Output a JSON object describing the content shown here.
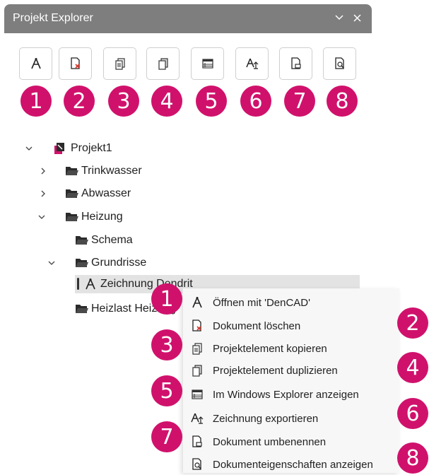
{
  "panel": {
    "title": "Projekt Explorer",
    "controls": {
      "collapse": "⌄",
      "close": "✕"
    }
  },
  "toolbar": {
    "buttons": [
      {
        "icon": "open-drawing-icon"
      },
      {
        "icon": "delete-document-icon"
      },
      {
        "icon": "copy-element-icon"
      },
      {
        "icon": "duplicate-element-icon"
      },
      {
        "icon": "windows-explorer-icon"
      },
      {
        "icon": "export-drawing-icon"
      },
      {
        "icon": "rename-document-icon"
      },
      {
        "icon": "document-properties-icon"
      }
    ]
  },
  "badges": [
    "1",
    "2",
    "3",
    "4",
    "5",
    "6",
    "7",
    "8"
  ],
  "tree": {
    "project": "Projekt1",
    "trinkwasser": "Trinkwasser",
    "abwasser": "Abwasser",
    "heizung": "Heizung",
    "schema": "Schema",
    "grundrisse": "Grundrisse",
    "zeichnung": "Zeichnung Dendrit",
    "heizlast": "Heizlast Heizung"
  },
  "context_menu": {
    "items": [
      {
        "label": "Öffnen mit 'DenCAD'",
        "icon": "open-drawing-icon"
      },
      {
        "label": "Dokument löschen",
        "icon": "delete-document-icon"
      },
      {
        "label": "Projektelement kopieren",
        "icon": "copy-element-icon"
      },
      {
        "label": "Projektelement duplizieren",
        "icon": "duplicate-element-icon"
      },
      {
        "label": "Im Windows Explorer anzeigen",
        "icon": "windows-explorer-icon"
      },
      {
        "label": "Zeichnung exportieren",
        "icon": "export-drawing-icon"
      },
      {
        "label": "Dokument umbenennen",
        "icon": "rename-document-icon"
      },
      {
        "label": "Dokumenteigenschaften anzeigen",
        "icon": "document-properties-icon"
      }
    ]
  },
  "colors": {
    "titlebar": "#7e7e7e",
    "badge": "#d0116c",
    "selection": "#e3e3e3",
    "menu_bg": "#f7f7f7"
  }
}
